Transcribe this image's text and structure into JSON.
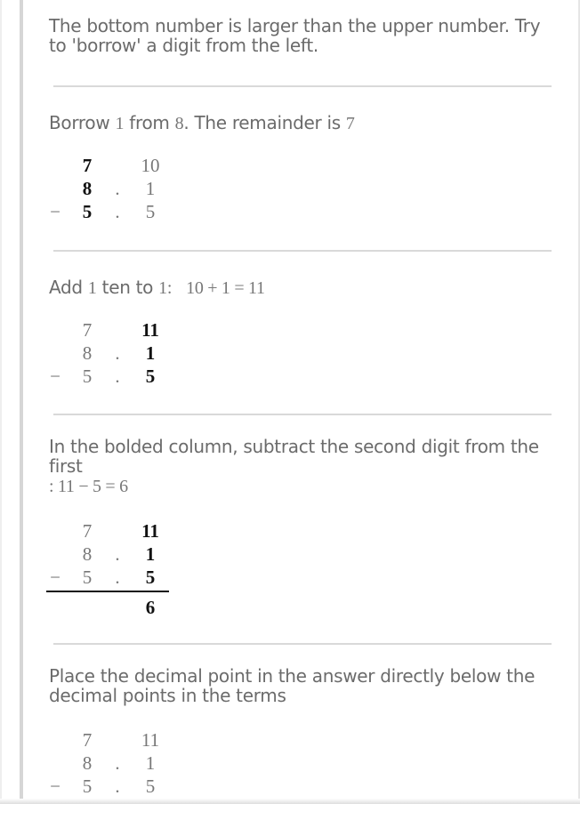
{
  "steps": [
    {
      "text": "The bottom number is larger than the upper number.  Try to 'borrow' a digit from the left."
    },
    {
      "text_parts": [
        "Borrow ",
        "1",
        " from ",
        "8",
        ".  The remainder is ",
        "7"
      ],
      "table": {
        "rows": [
          {
            "sign": "",
            "left": "7",
            "dot": "",
            "right": "10",
            "left_bold": true,
            "right_bold": false
          },
          {
            "sign": "",
            "left": "8",
            "dot": ".",
            "right": "1",
            "left_bold": true,
            "right_bold": false
          },
          {
            "sign": "−",
            "left": "5",
            "dot": ".",
            "right": "5",
            "left_bold": true,
            "right_bold": false
          }
        ]
      }
    },
    {
      "text_parts": [
        "Add ",
        "1",
        " ten to ",
        "1",
        ":",
        "10 + 1 = 11"
      ],
      "table": {
        "rows": [
          {
            "sign": "",
            "left": "7",
            "dot": "",
            "right": "11",
            "left_bold": false,
            "right_bold": true
          },
          {
            "sign": "",
            "left": "8",
            "dot": ".",
            "right": "1",
            "left_bold": false,
            "right_bold": true
          },
          {
            "sign": "−",
            "left": "5",
            "dot": ".",
            "right": "5",
            "left_bold": false,
            "right_bold": true
          }
        ]
      }
    },
    {
      "text": "In the bolded column, subtract the second digit from the first",
      "math": ":    11 − 5 = 6",
      "table": {
        "rows": [
          {
            "sign": "",
            "left": "7",
            "dot": "",
            "right": "11",
            "left_bold": false,
            "right_bold": true
          },
          {
            "sign": "",
            "left": "8",
            "dot": ".",
            "right": "1",
            "left_bold": false,
            "right_bold": true
          },
          {
            "sign": "−",
            "left": "5",
            "dot": ".",
            "right": "5",
            "left_bold": false,
            "right_bold": true
          }
        ],
        "answer": "6"
      }
    },
    {
      "text": "Place the decimal point in the answer directly below the decimal points in the terms",
      "table": {
        "rows": [
          {
            "sign": "",
            "left": "7",
            "dot": "",
            "right": "11",
            "left_bold": false,
            "right_bold": false
          },
          {
            "sign": "",
            "left": "8",
            "dot": ".",
            "right": "1",
            "left_bold": false,
            "right_bold": false
          },
          {
            "sign": "−",
            "left": "5",
            "dot": ".",
            "right": "5",
            "left_bold": false,
            "right_bold": false
          }
        ]
      }
    }
  ]
}
